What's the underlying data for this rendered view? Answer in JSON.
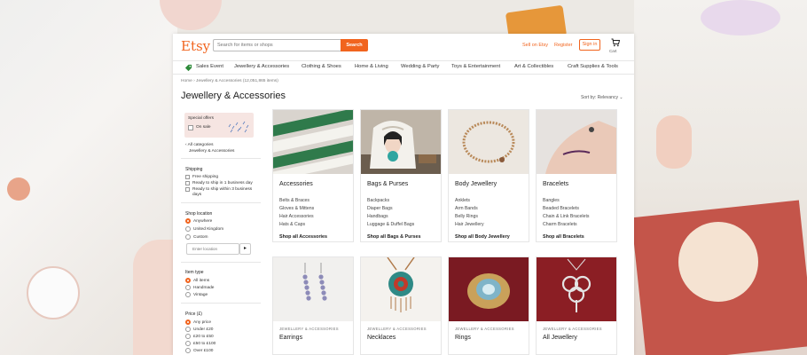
{
  "header": {
    "logo": "Etsy",
    "search_placeholder": "Search for items or shops",
    "search_button": "Search",
    "sell_link": "Sell on Etsy",
    "register_link": "Register",
    "signin_button": "Sign in",
    "cart_label": "Cart"
  },
  "nav": {
    "items": [
      "Sales Event",
      "Jewellery & Accessories",
      "Clothing & Shoes",
      "Home & Living",
      "Wedding & Party",
      "Toys & Entertainment",
      "Art & Collectibles",
      "Craft Supplies & Tools"
    ]
  },
  "breadcrumb": "Home › Jewellery & Accessories (12,051,865 items)",
  "page_title": "Jewellery & Accessories",
  "sort_label": "Sort by: Relevancy ⌄",
  "sidebar": {
    "special_offers_title": "Special offers",
    "on_sale_label": "On sale",
    "all_categories": "All categories",
    "current_category": "Jewellery & Accessories",
    "shipping": {
      "title": "Shipping",
      "options": [
        "Free shipping",
        "Ready to ship in 1 business day",
        "Ready to ship within 3 business",
        "days"
      ]
    },
    "location": {
      "title": "Shop location",
      "options": [
        "Anywhere",
        "United Kingdom",
        "Custom"
      ],
      "selected": "Anywhere",
      "input_placeholder": "Enter location",
      "go_button": "▸"
    },
    "item_type": {
      "title": "Item type",
      "options": [
        "All items",
        "Handmade",
        "Vintage"
      ],
      "selected": "All items"
    },
    "price": {
      "title": "Price (£)",
      "options": [
        "Any price",
        "Under £20",
        "£20 to £50",
        "£50 to £100",
        "Over £100"
      ],
      "selected": "Any price"
    }
  },
  "categories": [
    {
      "title": "Accessories",
      "items": [
        "Belts & Braces",
        "Gloves & Mittens",
        "Hair Accessories",
        "Hats & Caps"
      ],
      "all": "Shop all Accessories"
    },
    {
      "title": "Bags & Purses",
      "items": [
        "Backpacks",
        "Diaper Bags",
        "Handbags",
        "Luggage & Duffel Bags"
      ],
      "all": "Shop all Bags & Purses"
    },
    {
      "title": "Body Jewellery",
      "items": [
        "Anklets",
        "Arm Bands",
        "Belly Rings",
        "Hair Jewellery"
      ],
      "all": "Shop all Body Jewellery"
    },
    {
      "title": "Bracelets",
      "items": [
        "Bangles",
        "Beaded Bracelets",
        "Chain & Link Bracelets",
        "Charm Bracelets"
      ],
      "all": "Shop all Bracelets"
    }
  ],
  "listings": [
    {
      "kicker": "JEWELLERY & ACCESSORIES",
      "title": "Earrings"
    },
    {
      "kicker": "JEWELLERY & ACCESSORIES",
      "title": "Necklaces"
    },
    {
      "kicker": "JEWELLERY & ACCESSORIES",
      "title": "Rings"
    },
    {
      "kicker": "JEWELLERY & ACCESSORIES",
      "title": "All Jewellery"
    }
  ],
  "colors": {
    "brand": "#f1641e",
    "text": "#222222",
    "border": "#e6e6e6"
  }
}
